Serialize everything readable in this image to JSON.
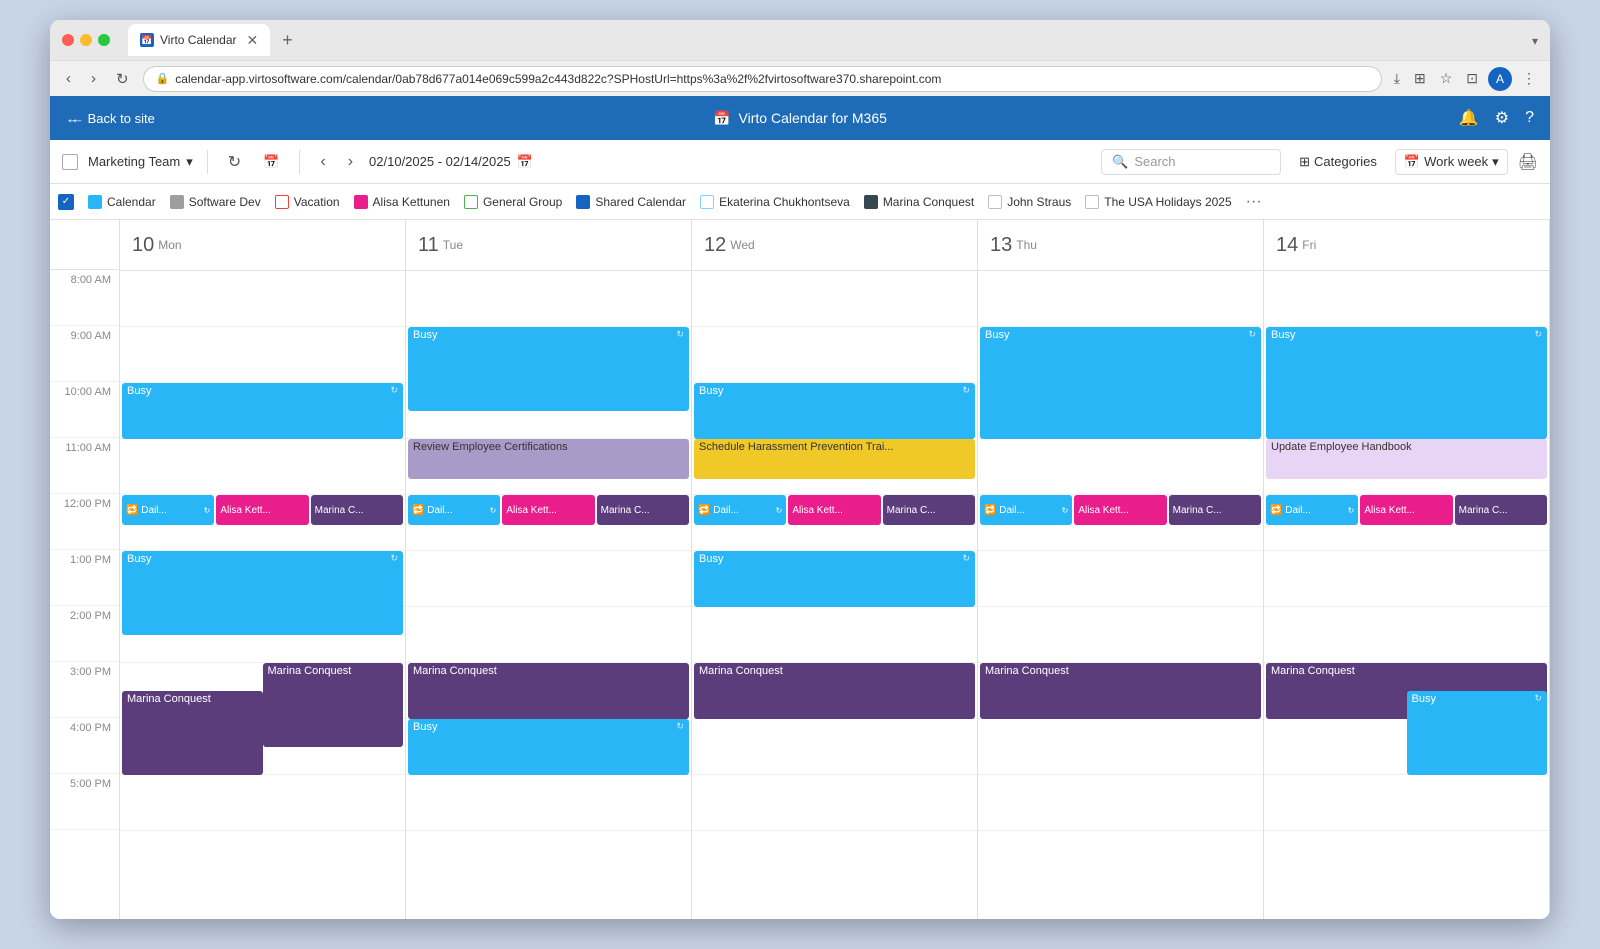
{
  "browser": {
    "url": "calendar-app.virtosoftware.com/calendar/0ab78d677a014e069c599a2c443d822c?SPHostUrl=https%3a%2f%2fvirtosoftware370.sharepoint.com",
    "tab_title": "Virto Calendar",
    "tab_new_label": "+",
    "chevron_label": "▾"
  },
  "nav": {
    "back_label": "← Back to site",
    "app_title": "Virto Calendar for M365"
  },
  "toolbar": {
    "team": "Marketing Team",
    "date_range": "02/10/2025 - 02/14/2025",
    "search_placeholder": "Search",
    "categories_label": "Categories",
    "view_label": "Work week"
  },
  "legend": {
    "items": [
      {
        "label": "Calendar",
        "color": "#29b6f6",
        "border": "#29b6f6",
        "checked": true
      },
      {
        "label": "Software Dev",
        "color": "#9e9e9e",
        "border": "#9e9e9e",
        "checked": false
      },
      {
        "label": "Vacation",
        "color": "#f44336",
        "border": "#f44336",
        "checked": false
      },
      {
        "label": "Alisa Kettunen",
        "color": "#e91e8c",
        "border": "#e91e8c",
        "checked": false
      },
      {
        "label": "General Group",
        "color": "#4caf50",
        "border": "#4caf50",
        "checked": false
      },
      {
        "label": "Shared Calendar",
        "color": "#1565c0",
        "border": "#1565c0",
        "checked": false
      },
      {
        "label": "Ekaterina Chukhontseva",
        "color": "#81d4fa",
        "border": "#81d4fa",
        "checked": false
      },
      {
        "label": "Marina Conquest",
        "color": "#37474f",
        "border": "#37474f",
        "checked": false
      },
      {
        "label": "John Straus",
        "color": "#b0bec5",
        "border": "#b0bec5",
        "checked": false
      },
      {
        "label": "The USA Holidays 2025",
        "color": "#eeeeee",
        "border": "#bdbdbd",
        "checked": false
      }
    ]
  },
  "days": [
    {
      "num": "10",
      "name": "Mon"
    },
    {
      "num": "11",
      "name": "Tue"
    },
    {
      "num": "12",
      "name": "Wed"
    },
    {
      "num": "13",
      "name": "Thu"
    },
    {
      "num": "14",
      "name": "Fri"
    }
  ],
  "time_slots": [
    "8:00 AM",
    "9:00 AM",
    "10:00 AM",
    "11:00 AM",
    "12:00 PM",
    "1:00 PM",
    "2:00 PM",
    "3:00 PM",
    "4:00 PM",
    "5:00 PM"
  ]
}
